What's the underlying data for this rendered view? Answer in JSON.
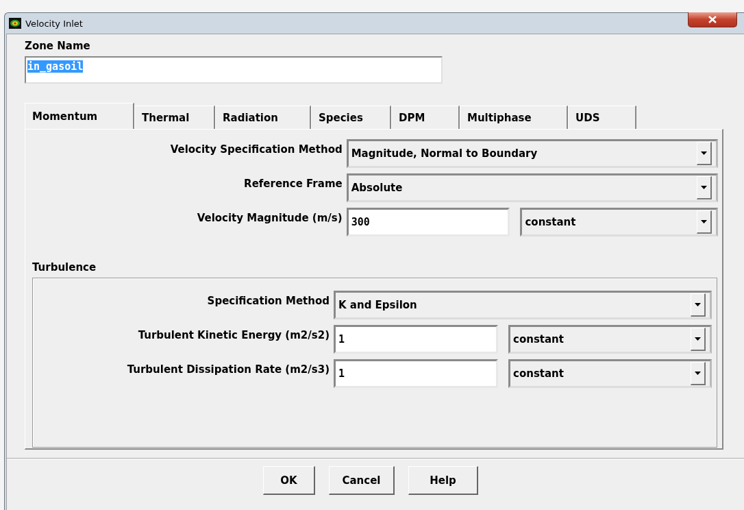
{
  "window": {
    "title": "Velocity Inlet"
  },
  "zone_name": {
    "label": "Zone Name",
    "value": "in_gasoil",
    "selected": true
  },
  "tabs": [
    {
      "label": "Momentum",
      "selected": true
    },
    {
      "label": "Thermal",
      "selected": false
    },
    {
      "label": "Radiation",
      "selected": false
    },
    {
      "label": "Species",
      "selected": false
    },
    {
      "label": "DPM",
      "selected": false
    },
    {
      "label": "Multiphase",
      "selected": false
    },
    {
      "label": "UDS",
      "selected": false
    }
  ],
  "momentum_rows": [
    {
      "kind": "dropdown",
      "label": "Velocity Specification Method",
      "value": "Magnitude, Normal to Boundary"
    },
    {
      "kind": "dropdown",
      "label": "Reference Frame",
      "value": "Absolute"
    },
    {
      "kind": "number",
      "label": "Velocity Magnitude (m/s)",
      "value": "300",
      "profile": "constant"
    }
  ],
  "turbulence": {
    "title": "Turbulence",
    "rows": [
      {
        "kind": "dropdown",
        "label": "Specification Method",
        "value": "K and Epsilon"
      },
      {
        "kind": "number",
        "label": "Turbulent Kinetic Energy (m2/s2)",
        "value": "1",
        "profile": "constant"
      },
      {
        "kind": "number",
        "label": "Turbulent Dissipation Rate (m2/s3)",
        "value": "1",
        "profile": "constant"
      }
    ]
  },
  "buttons": [
    "OK",
    "Cancel",
    "Help"
  ]
}
